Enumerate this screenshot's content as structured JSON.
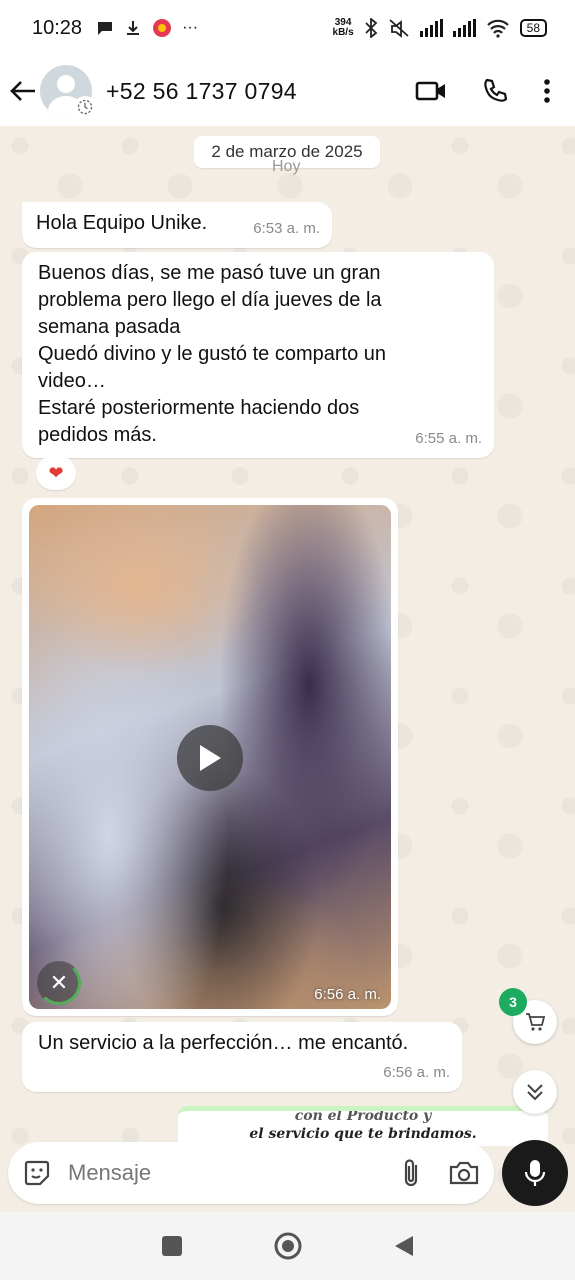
{
  "status_bar": {
    "time": "10:28",
    "speed_value": "394",
    "speed_unit": "kB/s",
    "battery": "58",
    "more": "···"
  },
  "header": {
    "contact": "+52 56 1737 0794"
  },
  "chat": {
    "date_chip": "2 de marzo de 2025",
    "today_label": "Hoy",
    "messages": [
      {
        "text": "Hola Equipo Unike.",
        "time": "6:53 a. m."
      },
      {
        "lines": [
          "Buenos días, se me pasó tuve un gran",
          "problema pero llego el día jueves de la",
          "semana pasada",
          "Quedó divino y le gustó te comparto un",
          "video…",
          "Estaré posteriormente haciendo dos",
          "pedidos más."
        ],
        "time": "6:55 a. m.",
        "reaction": "❤"
      },
      {
        "video": true,
        "time": "6:56 a. m.",
        "download_progress": 0.3
      },
      {
        "text": "Un servicio a la perfección… me encantó.",
        "time": "6:56 a. m."
      }
    ],
    "quoted_image_text": [
      "con el Producto y",
      "el servicio que te brindamos."
    ],
    "cart_badge": "3"
  },
  "composer": {
    "placeholder": "Mensaje"
  },
  "colors": {
    "accent_green": "#1daa61",
    "chat_bg": "#f3ede4"
  }
}
